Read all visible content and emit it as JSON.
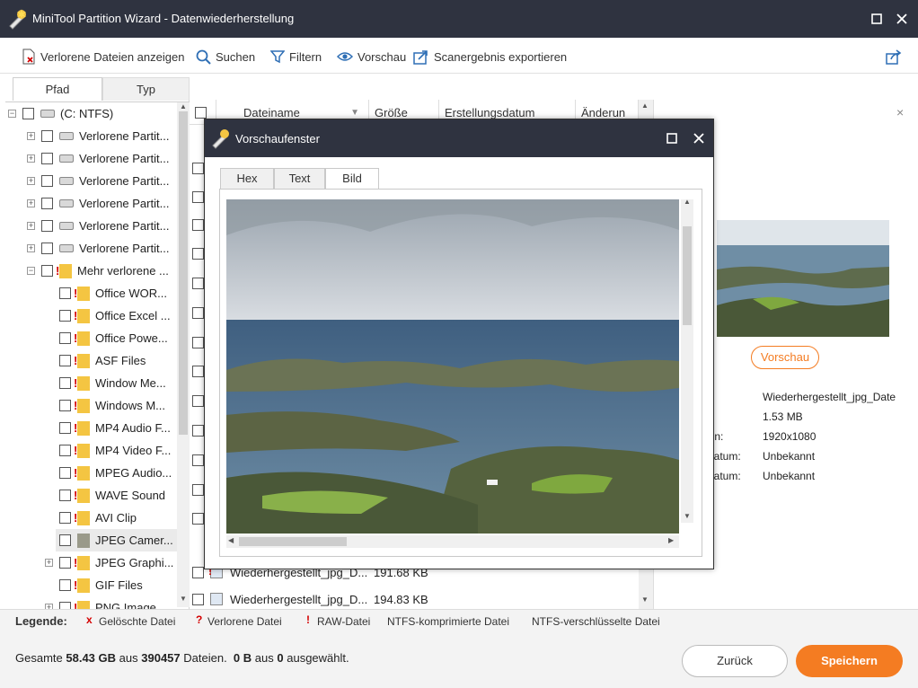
{
  "window": {
    "title": "MiniTool Partition Wizard - Datenwiederherstellung"
  },
  "toolbar": {
    "lost_files": "Verlorene Dateien anzeigen",
    "search": "Suchen",
    "filter": "Filtern",
    "preview": "Vorschau",
    "export": "Scanergebnis exportieren"
  },
  "tabs": {
    "path": "Pfad",
    "type": "Typ"
  },
  "tree": {
    "root": "(C: NTFS)",
    "lost_partitions": [
      "Verlorene Partit...",
      "Verlorene Partit...",
      "Verlorene Partit...",
      "Verlorene Partit...",
      "Verlorene Partit...",
      "Verlorene Partit..."
    ],
    "more_lost": "Mehr verlorene ...",
    "children": [
      "Office WOR...",
      "Office Excel ...",
      "Office Powe...",
      "ASF Files",
      "Window Me...",
      "Windows M...",
      "MP4 Audio F...",
      "MP4 Video F...",
      "MPEG Audio...",
      "WAVE Sound",
      "AVI Clip",
      "JPEG Camer...",
      "JPEG Graphi...",
      "GIF Files",
      "PNG Image"
    ]
  },
  "filelist": {
    "headers": {
      "name": "Dateiname",
      "size": "Größe",
      "created": "Erstellungsdatum",
      "modified": "Änderun"
    },
    "rows": [
      {
        "name": "Wiederhergestellt_jpg_D...",
        "size": "191.68 KB"
      },
      {
        "name": "Wiederhergestellt_jpg_D...",
        "size": "194.83 KB"
      }
    ]
  },
  "rightpanel": {
    "preview_button": "Vorschau",
    "details": [
      {
        "label": "e:",
        "value": "Wiederhergestellt_jpg_Date"
      },
      {
        "label": "",
        "value": "1.53 MB"
      },
      {
        "label": "hen:",
        "value": "1920x1080"
      },
      {
        "label": "sdatum:",
        "value": "Unbekannt"
      },
      {
        "label": "sdatum:",
        "value": "Unbekannt"
      }
    ]
  },
  "dialog": {
    "title": "Vorschaufenster",
    "tabs": {
      "hex": "Hex",
      "text": "Text",
      "image": "Bild"
    }
  },
  "legend": {
    "label": "Legende:",
    "deleted_mark": "x",
    "deleted": "Gelöschte Datei",
    "lost_mark": "?",
    "lost": "Verlorene Datei",
    "raw_mark": "!",
    "raw": "RAW-Datei",
    "compressed": "NTFS-komprimierte Datei",
    "encrypted": "NTFS-verschlüsselte Datei"
  },
  "status": {
    "prefix": "Gesamte",
    "total_size": "58.43 GB",
    "of": "aus",
    "file_count": "390457",
    "files": "Dateien.",
    "selected_size": "0 B",
    "of2": "aus",
    "selected_count": "0",
    "selected": "ausgewählt."
  },
  "buttons": {
    "back": "Zurück",
    "save": "Speichern"
  },
  "colors": {
    "titlebar": "#2f3340",
    "accent": "#f47c22",
    "deleted": "#d40000"
  }
}
